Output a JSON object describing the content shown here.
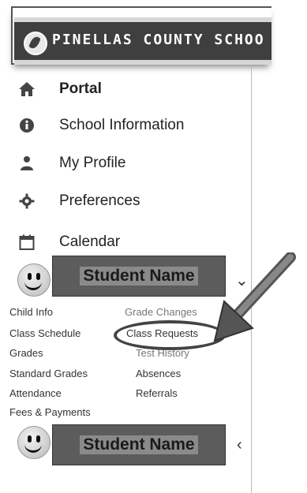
{
  "header": {
    "title": "PINELLAS COUNTY SCHOO"
  },
  "nav": [
    {
      "label": "Portal",
      "icon": "home-icon"
    },
    {
      "label": "School Information",
      "icon": "info-icon"
    },
    {
      "label": "My Profile",
      "icon": "user-icon"
    },
    {
      "label": "Preferences",
      "icon": "gear-icon"
    },
    {
      "label": "Calendar",
      "icon": "calendar-icon"
    }
  ],
  "students": [
    {
      "name": "Student Name",
      "expanded": true
    },
    {
      "name": "Student Name",
      "expanded": false
    }
  ],
  "student_links": [
    "Child Info",
    "Grade Changes",
    "Class Schedule",
    "Class Requests",
    "Grades",
    "Test History",
    "Standard Grades",
    "Absences",
    "Attendance",
    "Referrals",
    "Fees & Payments"
  ],
  "highlighted_link": "Class Requests"
}
